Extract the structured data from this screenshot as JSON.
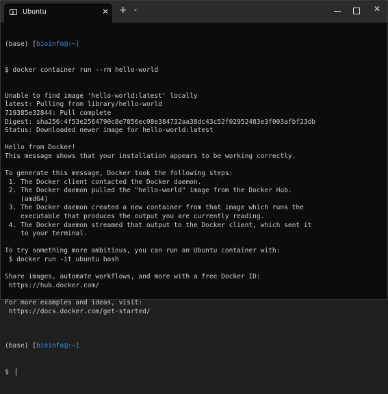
{
  "window": {
    "tab_title": "Ubuntu",
    "tab_icon": "terminal-icon",
    "new_tab_icon": "plus-icon",
    "dropdown_icon": "chevron-down-icon",
    "controls": [
      "minimize-icon",
      "maximize-icon",
      "close-icon"
    ]
  },
  "terminal": {
    "prompt_open": "(base) [",
    "prompt_user": "bioinfo@",
    "prompt_path": ":~]",
    "prompt_dollar": "$ ",
    "command": "docker container run --rm hello-world",
    "output": [
      "Unable to find image 'hello-world:latest' locally",
      "latest: Pulling from library/hello-world",
      "719385e32844: Pull complete",
      "Digest: sha256:4f53e2564790c8e7856ec08e384732aa38dc43c52f02952483e3f003afbf23db",
      "Status: Downloaded newer image for hello-world:latest",
      "",
      "Hello from Docker!",
      "This message shows that your installation appears to be working correctly.",
      "",
      "To generate this message, Docker took the following steps:",
      " 1. The Docker client contacted the Docker daemon.",
      " 2. The Docker daemon pulled the \"hello-world\" image from the Docker Hub.",
      "    (amd64)",
      " 3. The Docker daemon created a new container from that image which runs the",
      "    executable that produces the output you are currently reading.",
      " 4. The Docker daemon streamed that output to the Docker client, which sent it",
      "    to your terminal.",
      "",
      "To try something more ambitious, you can run an Ubuntu container with:",
      " $ docker run -it ubuntu bash",
      "",
      "Share images, automate workflows, and more with a free Docker ID:",
      " https://hub.docker.com/",
      "",
      "For more examples and ideas, visit:",
      " https://docs.docker.com/get-started/",
      ""
    ],
    "colors": {
      "background": "#0c0c0c",
      "text": "#cccccc",
      "prompt_blue": "#3b8eea"
    }
  }
}
